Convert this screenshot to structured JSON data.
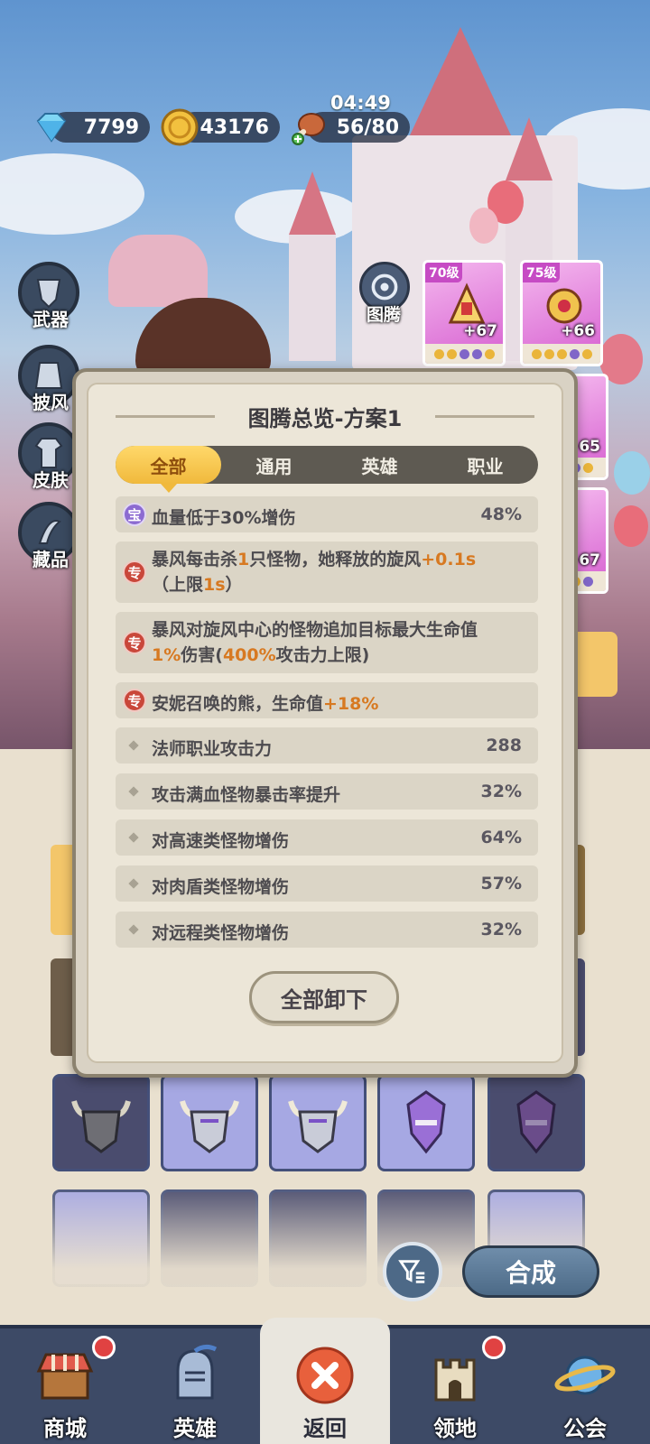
{
  "resources": {
    "timer": "04:49",
    "gems": "7799",
    "coins": "43176",
    "stamina": "56/80"
  },
  "side_menu": {
    "weapon": "武器",
    "cape": "披风",
    "skin": "皮肤",
    "collection": "藏品",
    "totem": "图腾"
  },
  "equipment_cards": [
    {
      "level": "70级",
      "bonus": "+67"
    },
    {
      "level": "75级",
      "bonus": "+66"
    },
    {
      "level": "",
      "bonus": "+65"
    },
    {
      "level": "",
      "bonus": "+67"
    }
  ],
  "modal": {
    "title": "图腾总览-方案1",
    "tabs": [
      "全部",
      "通用",
      "英雄",
      "职业"
    ],
    "active_tab": "全部",
    "rows": [
      {
        "badge": "宝",
        "text": "血量低于30%增伤",
        "value": "48%"
      },
      {
        "badge": "专",
        "parts": [
          "暴风每击杀",
          "1",
          "只怪物，她释放的旋风",
          "+0.1s",
          "（上限",
          "1s",
          "）"
        ]
      },
      {
        "badge": "专",
        "parts": [
          "暴风对旋风中心的怪物追加目标最大生命值",
          "1%",
          "伤害(",
          "400%",
          "攻击力上限)"
        ]
      },
      {
        "badge": "专",
        "parts": [
          "安妮召唤的熊，生命值",
          "+18%"
        ]
      },
      {
        "text": "法师职业攻击力",
        "value": "288"
      },
      {
        "text": "攻击满血怪物暴击率提升",
        "value": "32%"
      },
      {
        "text": "对高速类怪物增伤",
        "value": "64%"
      },
      {
        "text": "对肉盾类怪物增伤",
        "value": "57%"
      },
      {
        "text": "对远程类怪物增伤",
        "value": "32%"
      }
    ],
    "unequip_all": "全部卸下"
  },
  "bag": {
    "compose": "合成"
  },
  "nav": {
    "shop": "商城",
    "heroes": "英雄",
    "back": "返回",
    "territory": "领地",
    "guild": "公会"
  },
  "colors": {
    "highlight": "#d77921",
    "tab_active": "#f0b93c",
    "nav_bg": "#3d4a66",
    "badge_red": "#c9473a",
    "badge_purple": "#8c6bd1"
  }
}
